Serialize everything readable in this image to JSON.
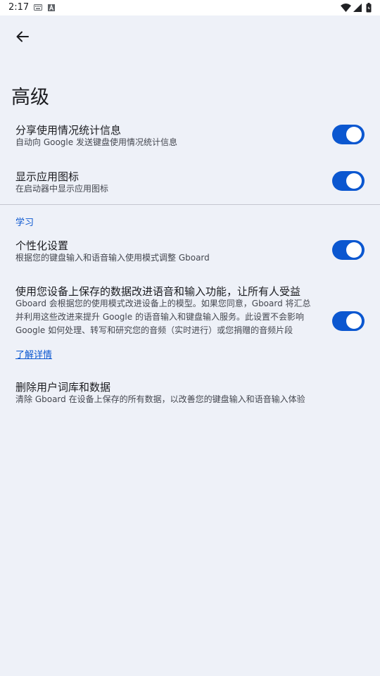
{
  "status_bar": {
    "time": "2:17",
    "icons": [
      "keyboard-icon",
      "a-icon",
      "wifi-icon",
      "signal-icon",
      "battery-icon"
    ]
  },
  "app_bar": {
    "back_icon": "arrow-back-icon"
  },
  "page": {
    "title": "高级"
  },
  "settings": [
    {
      "title": "分享使用情况统计信息",
      "subtitle": "自动向 Google 发送键盘使用情况统计信息",
      "toggle": true
    },
    {
      "title": "显示应用图标",
      "subtitle": "在启动器中显示应用图标",
      "toggle": true
    }
  ],
  "learning_section": {
    "header": "学习",
    "personalization": {
      "title": "个性化设置",
      "subtitle": "根据您的键盘输入和语音输入使用模式调整 Gboard",
      "toggle": true
    },
    "improve": {
      "title": "使用您设备上保存的数据改进语音和输入功能，让所有人受益",
      "subtitle": "Gboard 会根据您的使用模式改进设备上的模型。如果您同意，Gboard 将汇总并利用这些改进来提升 Google 的语音输入和键盘输入服务。此设置不会影响 Google 如何处理、转写和研究您的音频（实时进行）或您捐赠的音频片段",
      "toggle": true
    },
    "learn_more": "了解详情",
    "delete": {
      "title": "删除用户词库和数据",
      "subtitle": "清除 Gboard 在设备上保存的所有数据，以改善您的键盘输入和语音输入体验"
    }
  },
  "colors": {
    "accent": "#0b57d0",
    "background": "#eef1f8"
  }
}
